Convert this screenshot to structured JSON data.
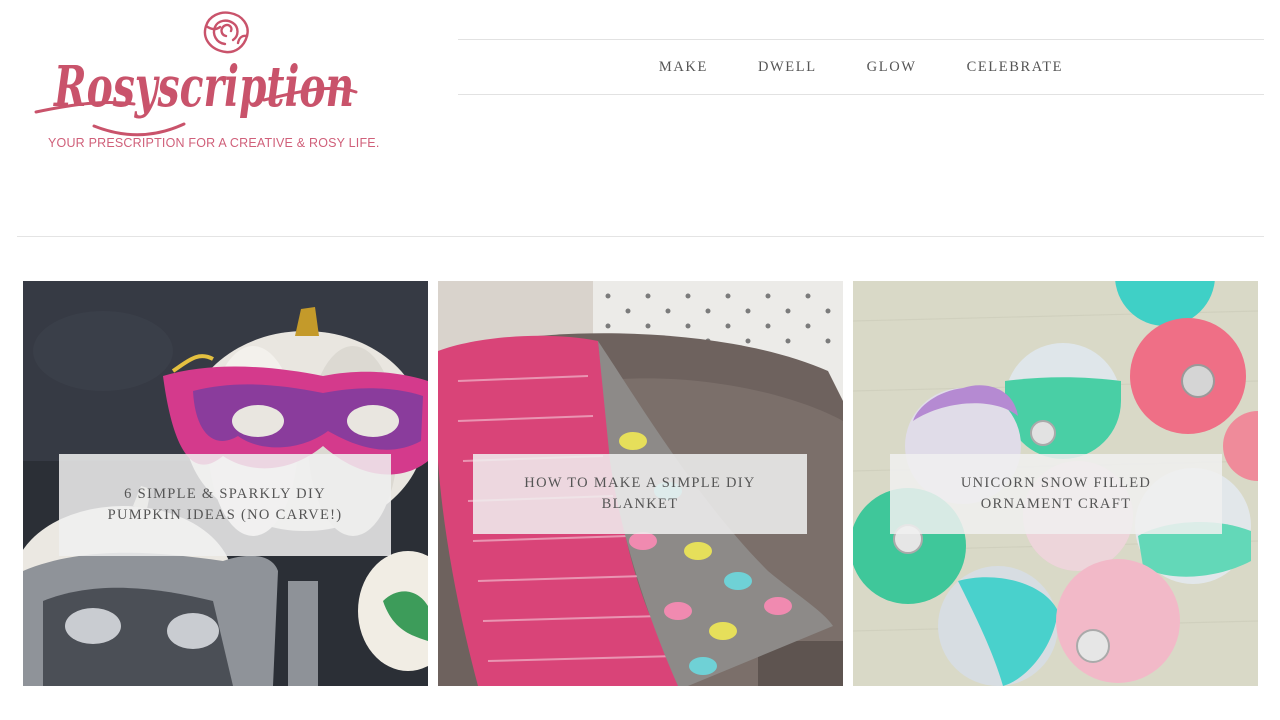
{
  "site": {
    "logo_text": "Rosyscription",
    "tagline": "YOUR PRESCRIPTION FOR A CREATIVE & ROSY LIFE.",
    "brand_color": "#c9536b",
    "logo_icon": "rose-icon"
  },
  "nav": {
    "items": [
      {
        "label": "MAKE"
      },
      {
        "label": "DWELL"
      },
      {
        "label": "GLOW"
      },
      {
        "label": "CELEBRATE"
      }
    ]
  },
  "posts": [
    {
      "title": "6 SIMPLE & SPARKLY DIY PUMPKIN IDEAS (NO CARVE!)",
      "image": "pumpkins-with-masks-photo"
    },
    {
      "title": "HOW TO MAKE A SIMPLE DIY BLANKET",
      "image": "pink-blanket-on-chair-photo"
    },
    {
      "title": "UNICORN SNOW FILLED ORNAMENT CRAFT",
      "image": "pastel-ornaments-photo"
    }
  ]
}
